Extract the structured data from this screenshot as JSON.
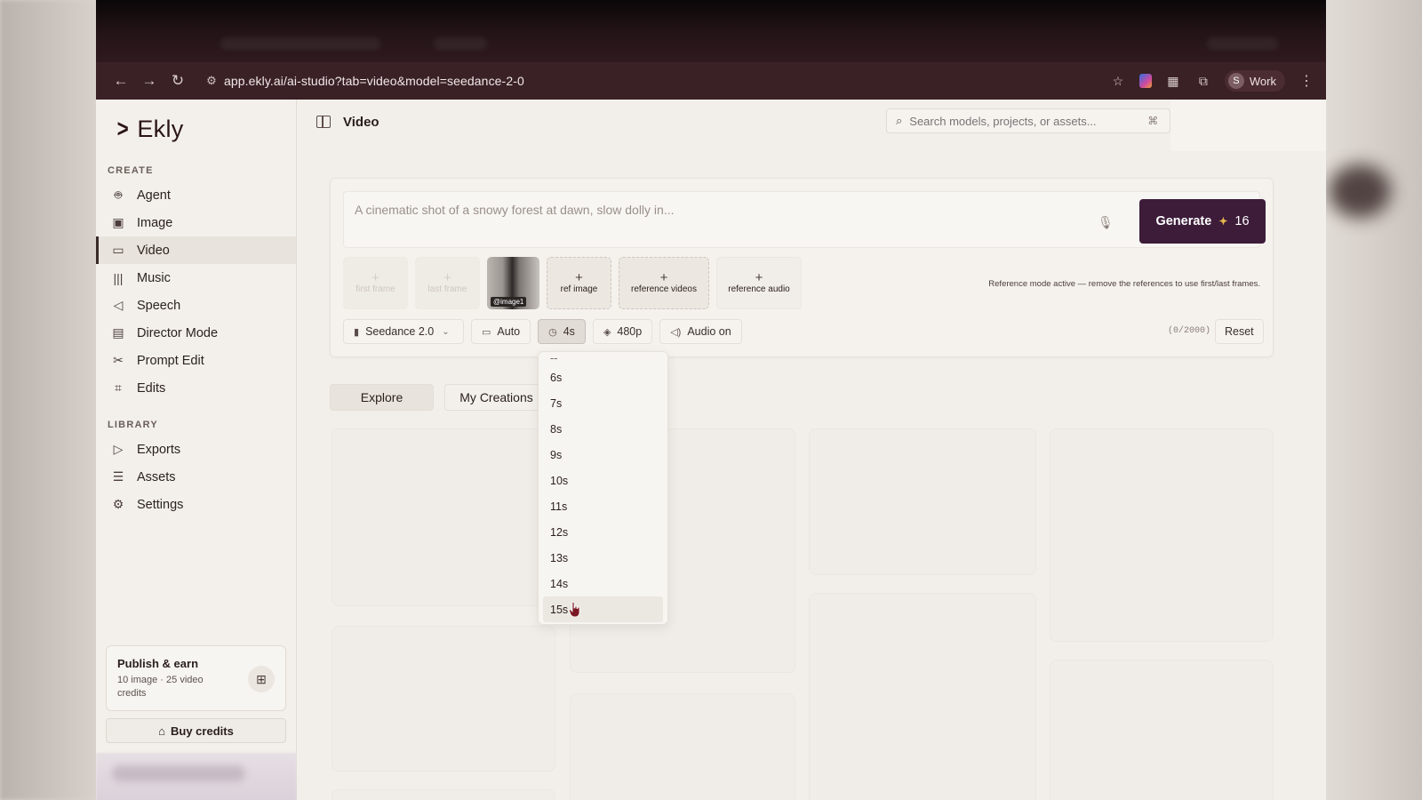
{
  "browser": {
    "url": "app.ekly.ai/ai-studio?tab=video&model=seedance-2-0",
    "profile_initial": "S",
    "profile_name": "Work"
  },
  "app": {
    "logo_text": "Ekly",
    "sidebar": {
      "create_label": "CREATE",
      "create_items": [
        {
          "label": "Agent",
          "icon": "robot-icon"
        },
        {
          "label": "Image",
          "icon": "image-icon"
        },
        {
          "label": "Video",
          "icon": "video-icon",
          "active": true
        },
        {
          "label": "Music",
          "icon": "waveform-icon"
        },
        {
          "label": "Speech",
          "icon": "speech-bubble-icon"
        },
        {
          "label": "Director Mode",
          "icon": "clapperboard-icon"
        },
        {
          "label": "Prompt Edit",
          "icon": "scissors-icon"
        },
        {
          "label": "Edits",
          "icon": "crop-icon"
        }
      ],
      "library_label": "LIBRARY",
      "library_items": [
        {
          "label": "Exports",
          "icon": "play-icon"
        },
        {
          "label": "Assets",
          "icon": "database-icon"
        },
        {
          "label": "Settings",
          "icon": "gear-icon"
        }
      ],
      "publish": {
        "title": "Publish & earn",
        "subtitle": "10 image · 25 video credits"
      },
      "buy_credits_label": "Buy credits"
    },
    "main": {
      "page_title": "Video",
      "search_placeholder": "Search models, projects, or assets...",
      "search_shortcut": "⌘",
      "prompt_placeholder": "A cinematic shot of a snowy forest at dawn, slow dolly in...",
      "generate_label": "Generate",
      "generate_credits": "16",
      "references": {
        "first_frame": "first frame",
        "last_frame": "last frame",
        "image_tag": "@image1",
        "ref_image": "ref image",
        "reference_videos": "reference videos",
        "reference_audio": "reference audio",
        "note": "Reference mode active — remove the references to use first/last frames."
      },
      "options": {
        "model": "Seedance 2.0",
        "aspect": "Auto",
        "duration": "4s",
        "resolution": "480p",
        "audio": "Audio on",
        "char_counter": "(0/2000)",
        "reset": "Reset"
      },
      "tabs": [
        "Explore",
        "My Creations"
      ],
      "duration_dropdown": {
        "partial_top": "--",
        "options": [
          "6s",
          "7s",
          "8s",
          "9s",
          "10s",
          "11s",
          "12s",
          "13s",
          "14s",
          "15s"
        ],
        "hovered": "15s"
      }
    }
  },
  "colors": {
    "accent": "#3d1c3a",
    "chrome": "#3a2126",
    "background": "#f2efea"
  }
}
